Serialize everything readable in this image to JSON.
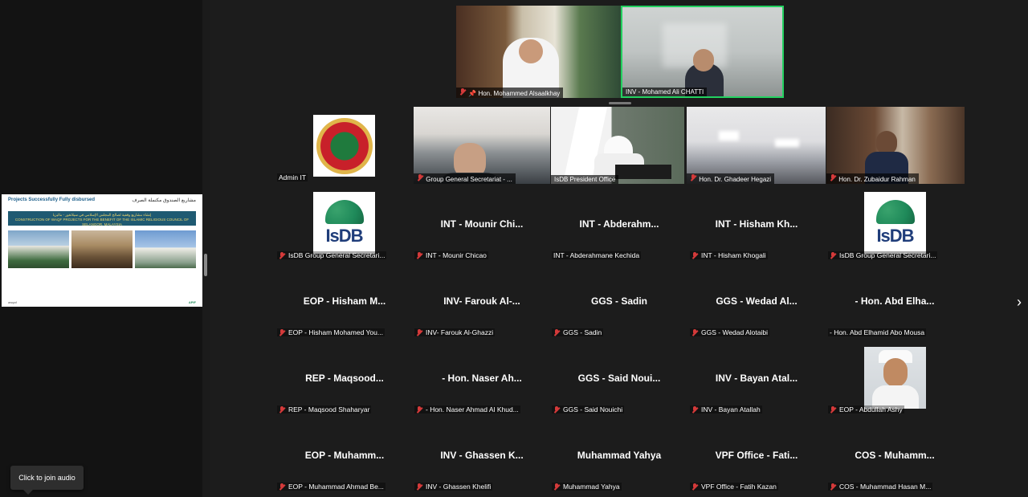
{
  "shared_screen": {
    "title_en": "Projects Successfully Fully disbursed",
    "title_ar": "مشاريع الصندوق مكتملة الصرف",
    "banner_ar": "إنشاء مشاريع وقفية لصالح المجلس الإسلامي في سيلانغور - ماليزيا",
    "banner_en": "CONSTRUCTION OF WAQF PROJECTS FOR THE BENEFIT OF THE ISLAMIC RELIGIOUS COUNCIL OF SELANGOR, MALAYSIA",
    "footer_left": "awqaf",
    "footer_right": "APIF"
  },
  "join_audio_label": "Click to join audio",
  "top_videos": [
    {
      "name": "Hon. Mohammed Alsaalkhay",
      "muted": true,
      "pinned": true
    },
    {
      "name": "INV - Mohamed Ali CHATTI",
      "muted": false,
      "pinned": false,
      "active_speaker": true
    }
  ],
  "video_row": [
    {
      "name": "Admin IT",
      "muted": false
    },
    {
      "name": "Group General Secretariat - ...",
      "muted": true
    },
    {
      "name": "IsDB President Office",
      "muted": false
    },
    {
      "name": "Hon. Dr. Ghadeer Hegazi",
      "muted": true
    },
    {
      "name": "Hon. Dr. Zubaidur Rahman",
      "muted": true
    }
  ],
  "isdb_logo_text": "IsDB",
  "grid_rows": [
    [
      {
        "big": "",
        "label": "IsDB Group General Secretari...",
        "muted": true,
        "avatar": "isdb"
      },
      {
        "big": "INT - Mounir Chi...",
        "label": "INT - Mounir Chicao",
        "muted": true
      },
      {
        "big": "INT - Abderahm...",
        "label": "INT - Abderahmane Kechida",
        "muted": false
      },
      {
        "big": "INT - Hisham Kh...",
        "label": "INT - Hisham Khogali",
        "muted": true
      },
      {
        "big": "",
        "label": "IsDB Group General Secretari...",
        "muted": true,
        "avatar": "isdb"
      }
    ],
    [
      {
        "big": "EOP - Hisham M...",
        "label": "EOP - Hisham Mohamed You...",
        "muted": true
      },
      {
        "big": "INV- Farouk Al-...",
        "label": "INV- Farouk Al-Ghazzi",
        "muted": true
      },
      {
        "big": "GGS - Sadin",
        "label": "GGS - Sadin",
        "muted": true
      },
      {
        "big": "GGS - Wedad Al...",
        "label": "GGS - Wedad Alotaibi",
        "muted": true
      },
      {
        "big": "- Hon. Abd Elha...",
        "label": "- Hon. Abd Elhamid Abo Mousa",
        "muted": false
      }
    ],
    [
      {
        "big": "REP - Maqsood...",
        "label": "REP - Maqsood Shaharyar",
        "muted": true
      },
      {
        "big": "- Hon. Naser Ah...",
        "label": "- Hon. Naser Ahmad Al Khud...",
        "muted": true
      },
      {
        "big": "GGS - Said Noui...",
        "label": "GGS - Said Nouichi",
        "muted": true
      },
      {
        "big": "INV - Bayan Atal...",
        "label": "INV - Bayan Atallah",
        "muted": true
      },
      {
        "big": "",
        "label": "EOP - Abdullah Ashy",
        "muted": true,
        "avatar": "photo"
      }
    ],
    [
      {
        "big": "EOP - Muhamm...",
        "label": "EOP - Muhammad Ahmad Be...",
        "muted": true
      },
      {
        "big": "INV - Ghassen K...",
        "label": "INV - Ghassen Khelifi",
        "muted": true
      },
      {
        "big": "Muhammad Yahya",
        "label": "Muhammad Yahya",
        "muted": true
      },
      {
        "big": "VPF Office - Fati...",
        "label": "VPF Office - Fatih Kazan",
        "muted": true
      },
      {
        "big": "COS - Muhamm...",
        "label": "COS - Muhammad Hasan M...",
        "muted": true
      }
    ]
  ],
  "next_page_icon": "chevron-right-icon"
}
